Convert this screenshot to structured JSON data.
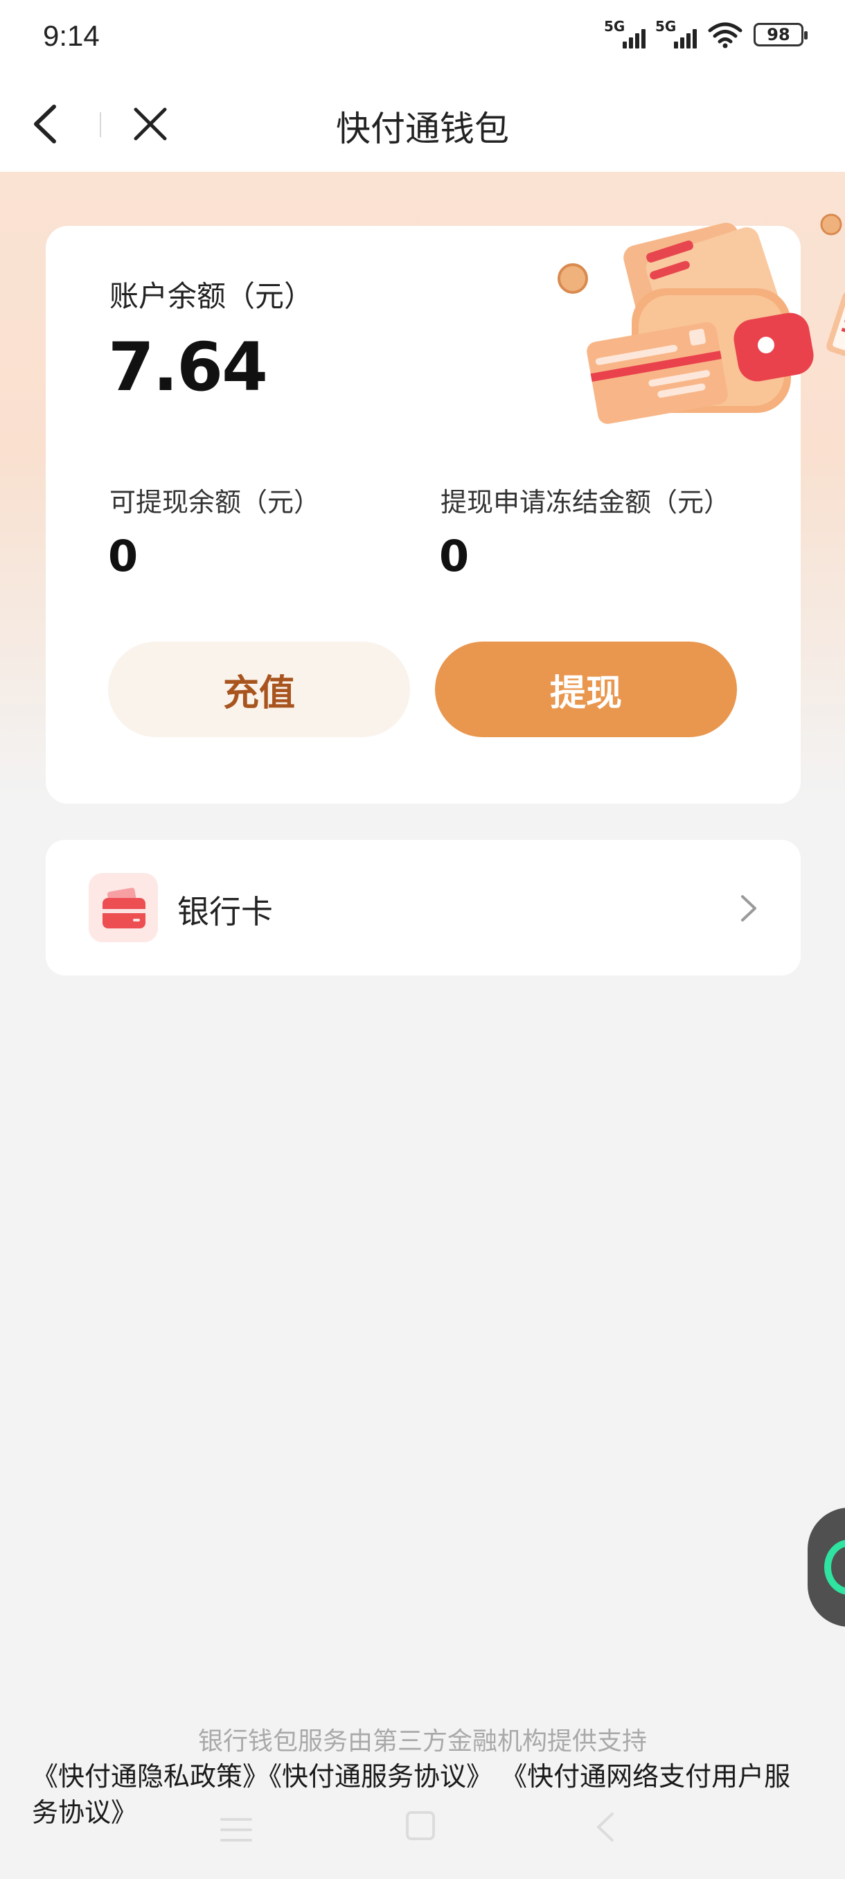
{
  "status_bar": {
    "time": "9:14",
    "signal1_label": "5G",
    "signal2_label": "5G",
    "battery": "98"
  },
  "nav": {
    "title": "快付通钱包",
    "back_icon": "chevron-left-icon",
    "close_icon": "close-icon"
  },
  "balance_card": {
    "balance_label": "账户余额（元）",
    "balance_value": "7.64",
    "withdrawable_label": "可提现余额（元）",
    "withdrawable_value": "0",
    "frozen_label": "提现申请冻结金额（元）",
    "frozen_value": "0",
    "recharge_label": "充值",
    "withdraw_label": "提现",
    "illustration_icon": "wallet-icon"
  },
  "bank_card": {
    "label": "银行卡",
    "icon": "bank-card-icon",
    "chevron_icon": "chevron-right-icon"
  },
  "footer": {
    "tagline": "银行钱包服务由第三方金融机构提供支持",
    "link1": "《快付通隐私政策》",
    "link2": "《快付通服务协议》",
    "link3": "《快付通网络支付用户服务协议》"
  },
  "colors": {
    "accent": "#e9964e",
    "recharge_text": "#a8541e",
    "recharge_bg": "#faf3ec",
    "hero_bg": "#fbe3d4"
  }
}
